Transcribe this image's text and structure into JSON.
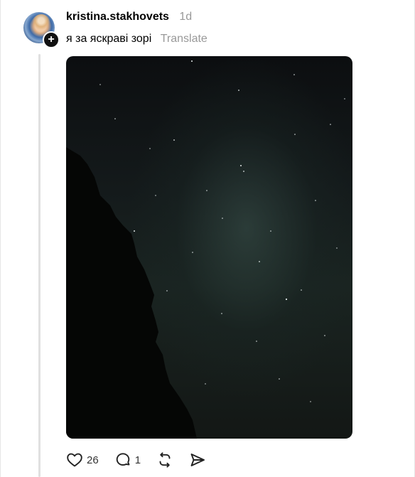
{
  "post": {
    "username": "kristina.stakhovets",
    "time_ago": "1d",
    "caption": "я за яскраві зорі",
    "translate_label": "Translate",
    "follow_symbol": "+"
  },
  "actions": {
    "likes": "26",
    "comments": "1"
  },
  "icons": {
    "like": "heart-icon",
    "comment": "comment-bubble-icon",
    "repost": "repost-icon",
    "share": "send-icon",
    "follow": "plus-icon"
  },
  "colors": {
    "muted_text": "#999999",
    "thread_line": "#e0e0e0",
    "badge": "#111111"
  }
}
